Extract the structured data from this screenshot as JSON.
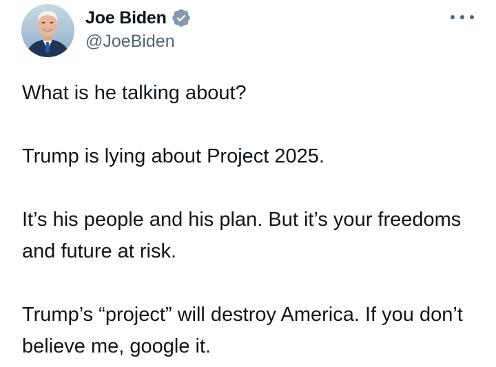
{
  "author": {
    "display_name": "Joe Biden",
    "handle": "@JoeBiden",
    "verified": true,
    "verified_icon": "verified-badge-icon",
    "avatar": "avatar"
  },
  "menu": {
    "icon": "more-options-icon"
  },
  "tweet": {
    "paragraphs": [
      "What is he talking about?",
      "Trump is lying about Project 2025.",
      "It’s his people and his plan. But it’s your freedoms and future at risk.",
      "Trump’s “project” will destroy America. If you don’t believe me, google it."
    ]
  },
  "colors": {
    "text": "#0f1419",
    "secondary": "#536471",
    "badge": "#829aab",
    "background": "#ffffff"
  }
}
